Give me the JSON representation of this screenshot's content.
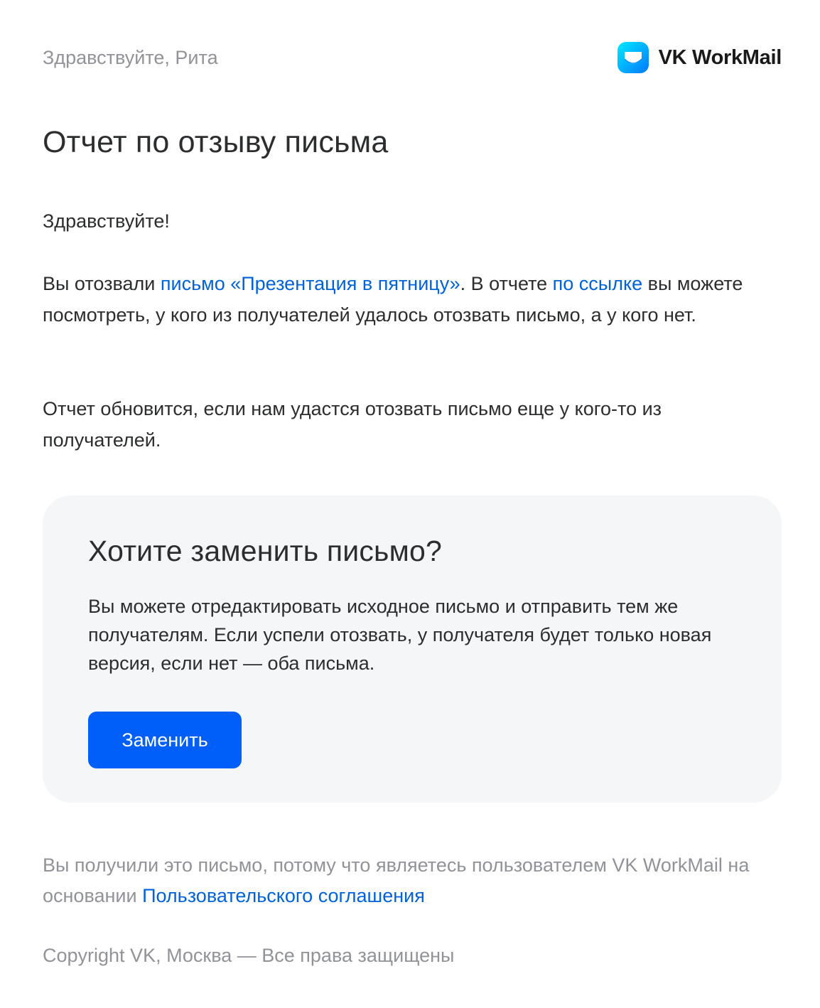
{
  "header": {
    "greeting": "Здравствуйте, Рита",
    "logo_text": "VK WorkMail",
    "logo_icon": "mail-envelope-icon"
  },
  "title": "Отчет по отзыву письма",
  "body": {
    "hello": "Здравствуйте!",
    "main_prefix": "Вы отозвали ",
    "main_link_letter": "письмо «Презентация в пятницу»",
    "main_middle": ". В отчете ",
    "main_link_report": "по ссылке",
    "main_suffix": " вы можете посмотреть, у кого из получателей удалось отозвать письмо, а у кого нет.",
    "update_note": "Отчет обновится, если нам удастся отозвать письмо еще у кого-то из получателей."
  },
  "card": {
    "title": "Хотите заменить письмо?",
    "text": "Вы можете отредактировать исходное письмо и отправить тем же получателям. Если успели отозвать, у получателя будет только новая версия, если нет — оба письма.",
    "button_label": "Заменить"
  },
  "footer": {
    "notice_prefix": "Вы получили это письмо, потому что являетесь пользователем VK WorkMail на основании ",
    "notice_link": "Пользовательского соглашения",
    "copyright": "Copyright VK, Москва — Все права защищены"
  },
  "colors": {
    "link": "#0063d9",
    "button": "#005ff9",
    "card_background": "#f5f6f8",
    "muted_text": "#919399",
    "logo_gradient_start": "#00eaff",
    "logo_gradient_end": "#0077ff"
  }
}
